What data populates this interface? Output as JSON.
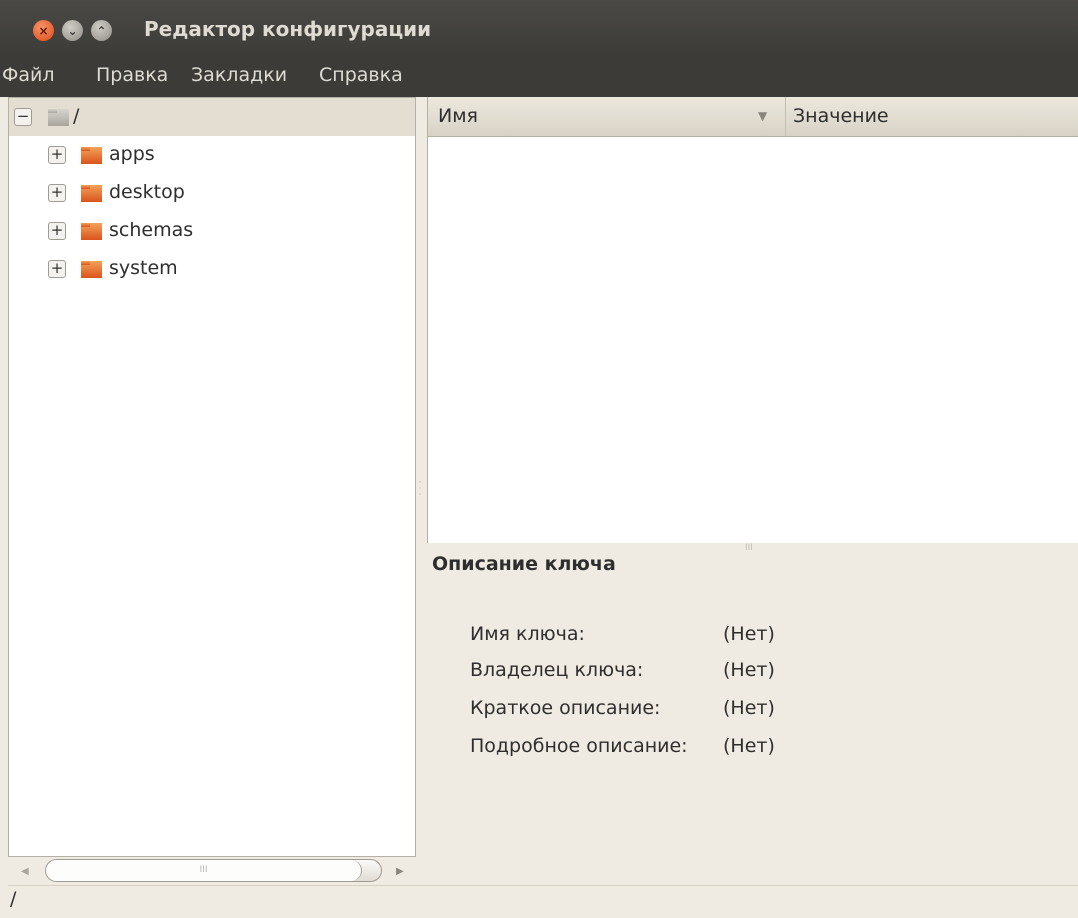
{
  "window": {
    "title": "Редактор конфигурации",
    "close_glyph": "×",
    "minimize_glyph": "⌄",
    "maximize_glyph": "⌃"
  },
  "menubar": {
    "items": [
      "Файл",
      "Правка",
      "Закладки",
      "Справка"
    ]
  },
  "tree": {
    "root": {
      "label": "/",
      "expander": "−",
      "icon": "folder-icon",
      "expanded": true
    },
    "children": [
      {
        "label": "apps",
        "expander": "+",
        "icon": "folder-icon"
      },
      {
        "label": "desktop",
        "expander": "+",
        "icon": "folder-icon"
      },
      {
        "label": "schemas",
        "expander": "+",
        "icon": "folder-icon"
      },
      {
        "label": "system",
        "expander": "+",
        "icon": "folder-icon"
      }
    ]
  },
  "list": {
    "columns": [
      "Имя",
      "Значение"
    ],
    "sort_indicator": "▼",
    "rows": []
  },
  "key_description": {
    "title": "Описание ключа",
    "fields": [
      {
        "label": "Имя ключа:",
        "value": "(Нет)"
      },
      {
        "label": "Владелец ключа:",
        "value": "(Нет)"
      },
      {
        "label": "Краткое описание:",
        "value": "(Нет)"
      },
      {
        "label": "Подробное описание:",
        "value": "(Нет)"
      }
    ]
  },
  "scrollbar": {
    "left_arrow": "◀",
    "right_arrow": "▶",
    "grip": "III"
  },
  "statusbar": {
    "path": "/"
  },
  "colors": {
    "titlebar": "#3c3b37",
    "close_button": "#df4a16",
    "folder": "#e8742f",
    "window_bg": "#f0ebe2"
  }
}
